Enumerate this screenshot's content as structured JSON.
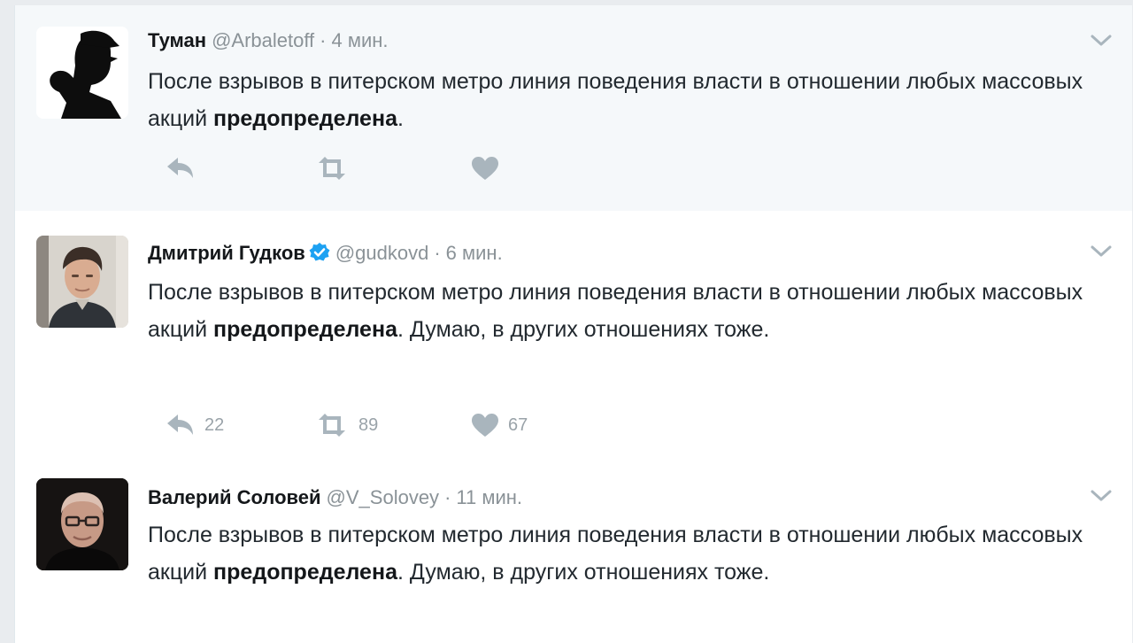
{
  "colors": {
    "icon": "#a9b5bd",
    "verified": "#1da1f2",
    "meta": "#8a9297",
    "text": "#22292f"
  },
  "tweets": [
    {
      "name": "Туман",
      "handle": "@Arbaletoff",
      "separator": "·",
      "time": "4 мин.",
      "verified": false,
      "text_before": "После взрывов в питерском метро линия поведения власти в отношении любых массовых акций ",
      "text_bold": "предопределена",
      "text_after": ".",
      "reply_count": "",
      "retweet_count": "",
      "like_count": ""
    },
    {
      "name": "Дмитрий Гудков",
      "handle": "@gudkovd",
      "separator": "·",
      "time": "6 мин.",
      "verified": true,
      "text_before": "После взрывов в питерском метро линия поведения власти в отношении любых массовых акций ",
      "text_bold": "предопределена",
      "text_after": ". Думаю, в других отношениях тоже.",
      "reply_count": "22",
      "retweet_count": "89",
      "like_count": "67"
    },
    {
      "name": "Валерий Соловей",
      "handle": "@V_Solovey",
      "separator": "·",
      "time": "11 мин.",
      "verified": false,
      "text_before": "После взрывов в питерском метро линия поведения власти в отношении любых массовых акций ",
      "text_bold": "предопределена",
      "text_after": ". Думаю, в других отношениях тоже."
    }
  ],
  "icons": {
    "more": "chevron-down-icon",
    "reply": "reply-icon",
    "retweet": "retweet-icon",
    "like": "heart-icon",
    "verified": "verified-badge-icon"
  }
}
